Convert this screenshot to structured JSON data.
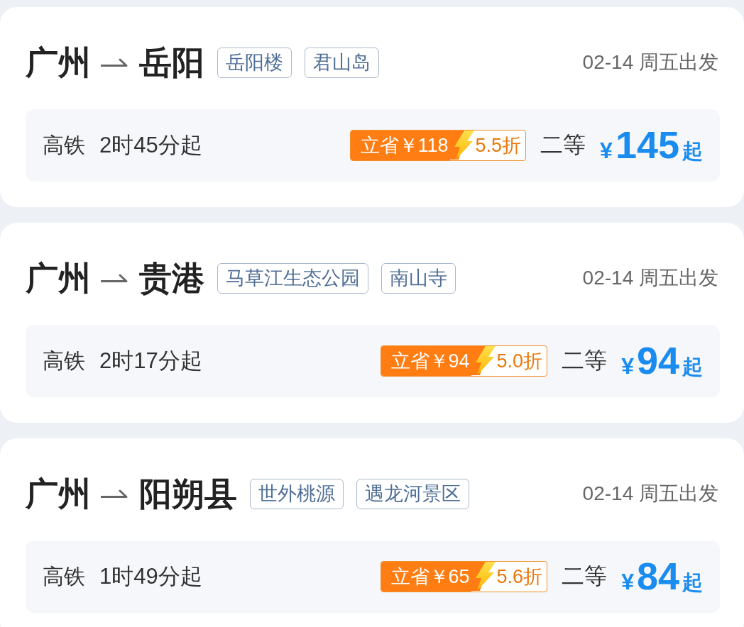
{
  "routes": [
    {
      "origin": "广州",
      "destination": "岳阳",
      "tags": [
        "岳阳楼",
        "君山岛"
      ],
      "departure": "02-14 周五出发",
      "train_type": "高铁",
      "duration": "2时45分起",
      "saving": "立省￥118",
      "discount": "5.5折",
      "seat_class": "二等",
      "currency": "¥",
      "price": "145",
      "price_suffix": "起"
    },
    {
      "origin": "广州",
      "destination": "贵港",
      "tags": [
        "马草江生态公园",
        "南山寺"
      ],
      "departure": "02-14 周五出发",
      "train_type": "高铁",
      "duration": "2时17分起",
      "saving": "立省￥94",
      "discount": "5.0折",
      "seat_class": "二等",
      "currency": "¥",
      "price": "94",
      "price_suffix": "起"
    },
    {
      "origin": "广州",
      "destination": "阳朔县",
      "tags": [
        "世外桃源",
        "遇龙河景区"
      ],
      "departure": "02-14 周五出发",
      "train_type": "高铁",
      "duration": "1时49分起",
      "saving": "立省￥65",
      "discount": "5.6折",
      "seat_class": "二等",
      "currency": "¥",
      "price": "84",
      "price_suffix": "起"
    }
  ]
}
